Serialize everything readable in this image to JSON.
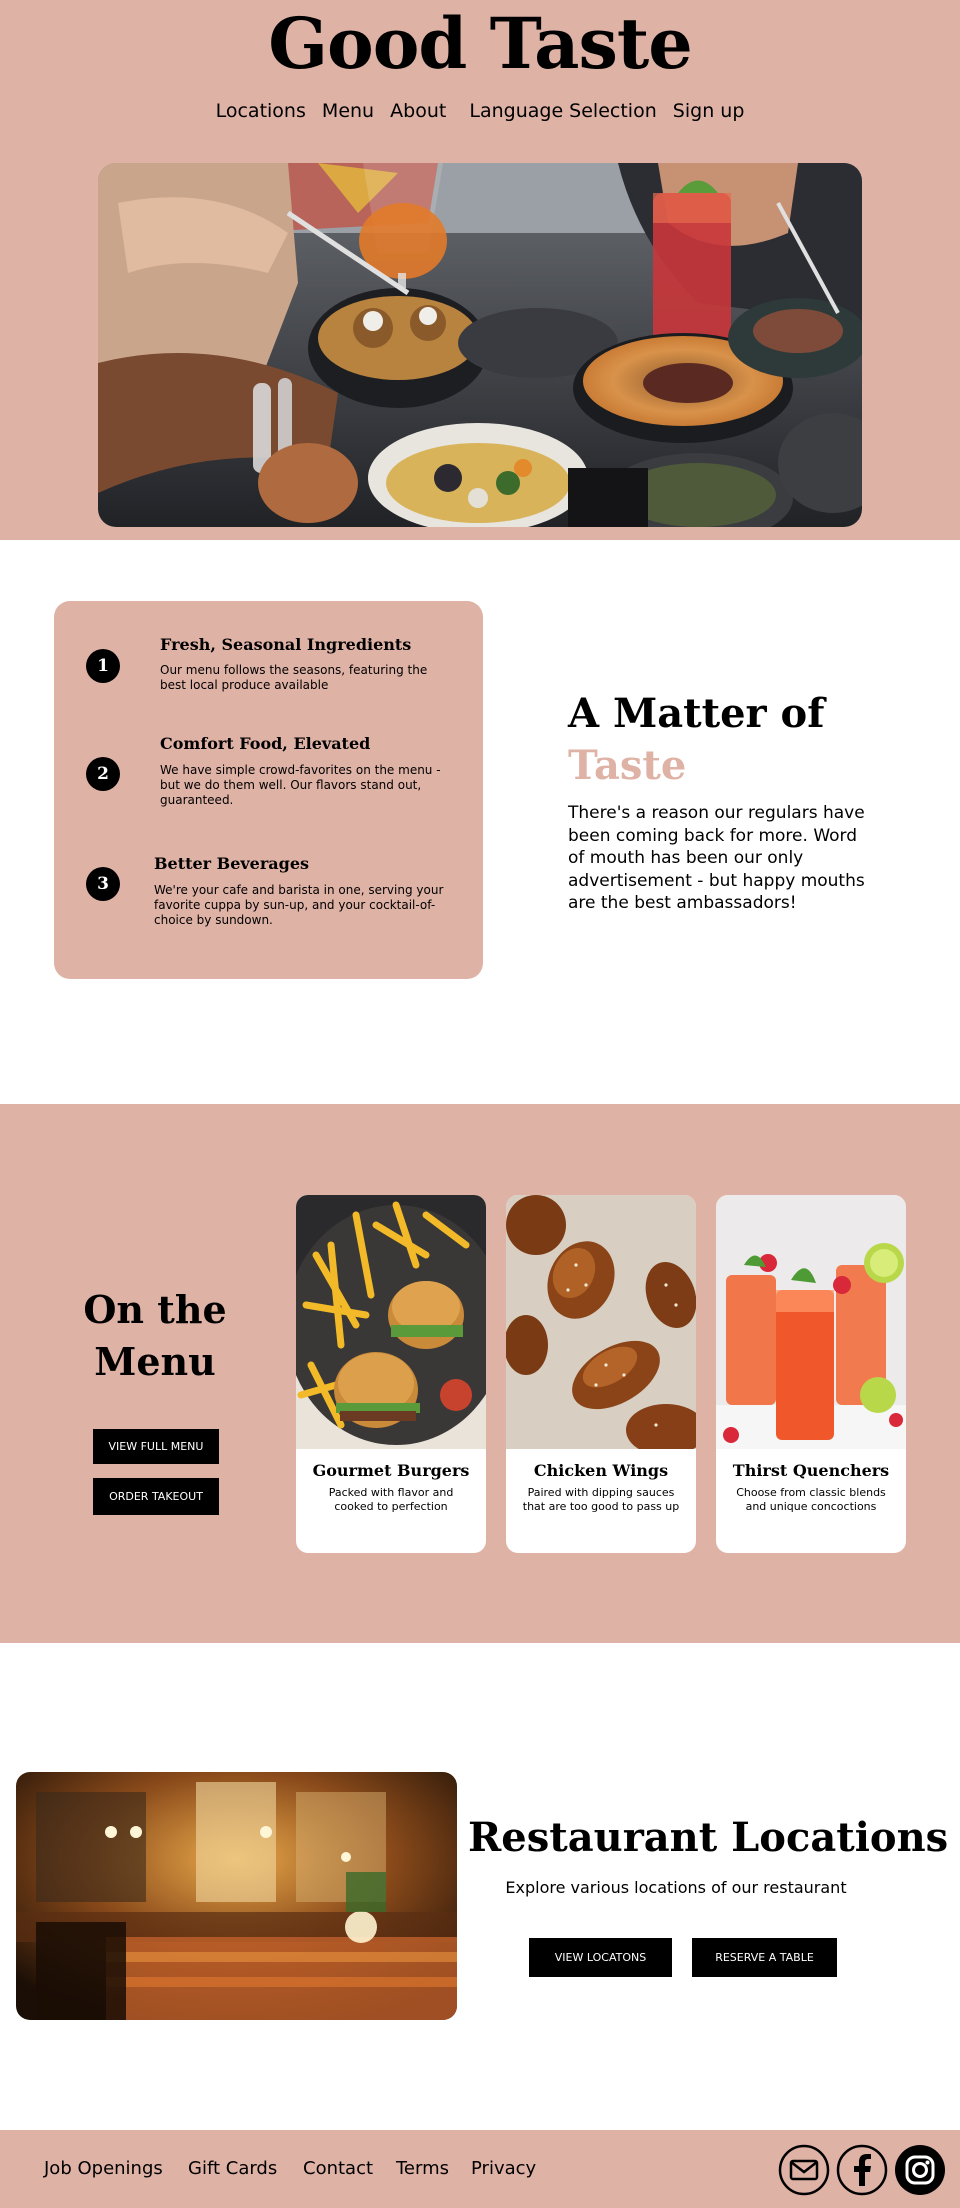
{
  "header": {
    "title": "Good Taste",
    "nav": [
      "Locations",
      "Menu",
      "About",
      "Language Selection",
      "Sign up"
    ]
  },
  "features": {
    "items": [
      {
        "number": "1",
        "title": "Fresh, Seasonal Ingredients",
        "description": "Our menu follows the seasons, featuring the best local produce available"
      },
      {
        "number": "2",
        "title": "Comfort Food, Elevated",
        "description": "We have simple crowd-favorites on the menu - but we do them well. Our flavors stand out, guaranteed."
      },
      {
        "number": "3",
        "title": "Better Beverages",
        "description": "We're your cafe and barista in one, serving your favorite cuppa by sun-up, and your cocktail-of-choice by sundown."
      }
    ],
    "heading_line1": "A Matter of",
    "heading_accent": "Taste",
    "body": "There's a reason our regulars have been coming back for more. Word of mouth has been our only advertisement - but happy mouths are the best ambassadors!"
  },
  "menu": {
    "heading_line1": "On the",
    "heading_line2": "Menu",
    "view_menu_label": "VIEW FULL MENU",
    "order_label": "ORDER TAKEOUT",
    "cards": [
      {
        "title": "Gourmet Burgers",
        "description": "Packed with flavor and cooked to perfection"
      },
      {
        "title": "Chicken Wings",
        "description": "Paired with dipping sauces that are too good to pass up"
      },
      {
        "title": "Thirst Quenchers",
        "description": "Choose from classic blends and unique concoctions"
      }
    ]
  },
  "locations": {
    "heading": "Restaurant Locations",
    "subtitle": "Explore various locations of our restaurant",
    "view_label": "VIEW LOCATONS",
    "reserve_label": "RESERVE A TABLE"
  },
  "footer": {
    "links": [
      "Job Openings",
      "Gift Cards",
      "Contact",
      "Terms",
      "Privacy"
    ],
    "icons": [
      "mail-icon",
      "facebook-icon",
      "instagram-icon"
    ]
  },
  "colors": {
    "accent": "#dfb2a6",
    "text": "#000000",
    "background": "#ffffff"
  }
}
